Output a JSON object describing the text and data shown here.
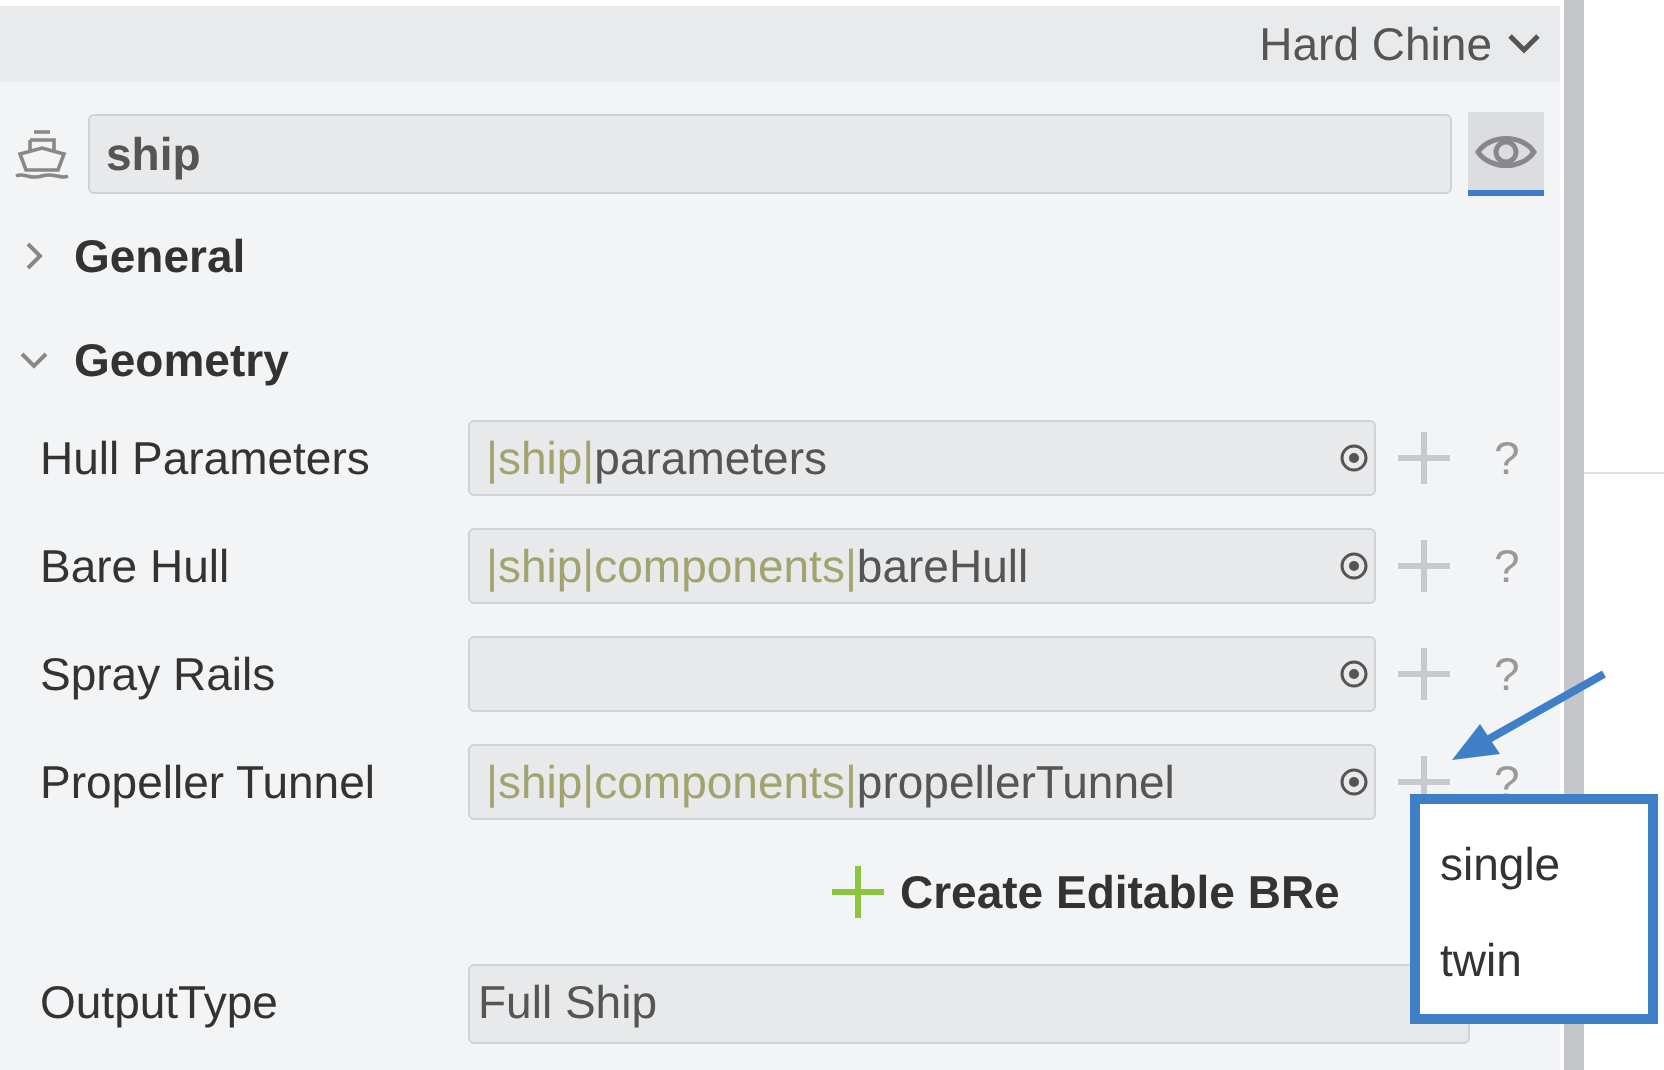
{
  "header": {
    "preset": "Hard Chine"
  },
  "object": {
    "name": "ship"
  },
  "view_toggle": {
    "selected": true
  },
  "sections": [
    {
      "title": "General",
      "expanded": false
    },
    {
      "title": "Geometry",
      "expanded": true
    }
  ],
  "properties": [
    {
      "label": "Hull Parameters",
      "prefix": "|ship|",
      "value": "parameters"
    },
    {
      "label": "Bare Hull",
      "prefix": "|ship|components|",
      "value": "bareHull"
    },
    {
      "label": "Spray Rails"
    },
    {
      "label": "Propeller Tunnel",
      "prefix": "|ship|components|",
      "value": "propellerTunnel"
    }
  ],
  "help_mark": "?",
  "create_button": "Create Editable BRe",
  "output": {
    "label": "OutputType",
    "value": "Full Ship"
  },
  "popup": {
    "options": [
      "single",
      "twin"
    ]
  }
}
